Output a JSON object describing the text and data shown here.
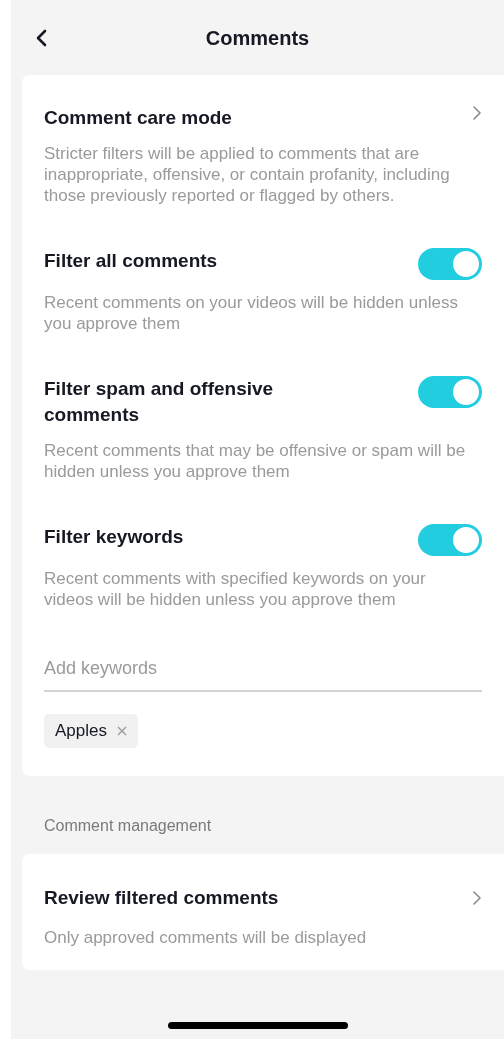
{
  "header": {
    "title": "Comments"
  },
  "settings": [
    {
      "kind": "link",
      "title": "Comment care mode",
      "description": "Stricter filters will be applied to comments that are inappropriate, offensive, or contain profanity, including those previously reported or flagged by others."
    },
    {
      "kind": "toggle",
      "title": "Filter all comments",
      "on": true,
      "description": "Recent comments on your videos will be hidden unless you approve them"
    },
    {
      "kind": "toggle",
      "title": "Filter spam and offensive comments",
      "on": true,
      "description": "Recent comments that may be offensive or spam will be hidden unless you approve them"
    },
    {
      "kind": "toggle",
      "title": "Filter keywords",
      "on": true,
      "description": "Recent comments with specified keywords on your videos will be hidden unless you approve them"
    }
  ],
  "keywords": {
    "placeholder": "Add keywords",
    "chips": [
      "Apples"
    ]
  },
  "management": {
    "heading": "Comment management",
    "items": [
      {
        "title": "Review filtered comments",
        "description": "Only approved comments will be displayed"
      }
    ]
  }
}
